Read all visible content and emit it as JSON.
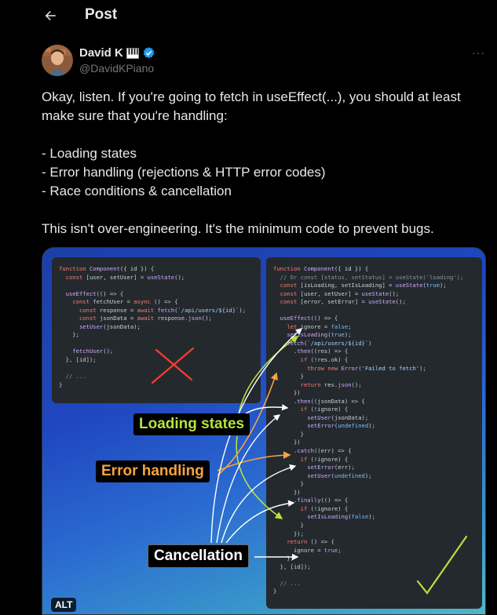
{
  "header": {
    "title": "Post",
    "back_icon": "arrow-left-icon"
  },
  "author": {
    "name": "David K",
    "name_emoji": "piano-icon",
    "verified_icon": "verified-badge-icon",
    "handle": "@DavidKPiano",
    "more_label": "···"
  },
  "post": {
    "lines": [
      "Okay, listen. If you're going to fetch in useEffect(...), you should at least make sure that you're handling:",
      "",
      "- Loading states",
      "- Error handling (rejections & HTTP error codes)",
      "- Race conditions & cancellation",
      "",
      "This isn't over-engineering. It's the minimum code to prevent bugs."
    ]
  },
  "media": {
    "alt_label": "ALT",
    "labels": {
      "loading": "Loading states",
      "error": "Error handling",
      "cancel": "Cancellation"
    },
    "colors": {
      "loading": "#b4e33d",
      "error": "#f5a442",
      "cancel": "#ffffff",
      "wrong": "#ff3b30",
      "right": "#b4e33d"
    },
    "left_code": [
      "function Component({ id }) {",
      "  const [user, setUser] = useState();",
      "",
      "  useEffect(() => {",
      "    const fetchUser = async () => {",
      "      const response = await fetch(`/api/users/${id}`);",
      "      const jsonData = await response.json();",
      "      setUser(jsonData);",
      "    };",
      "",
      "    fetchUser();",
      "  }, [id]);",
      "",
      "  // ...",
      "}"
    ],
    "right_code": [
      "function Component({ id }) {",
      "  // Or const [status, setStatus] = useState('loading');",
      "  const [isLoading, setIsLoading] = useState(true);",
      "  const [user, setUser] = useState();",
      "  const [error, setError] = useState();",
      "",
      "  useEffect(() => {",
      "    let ignore = false;",
      "    setIsLoading(true);",
      "    fetch(`/api/users/${id}`)",
      "      .then((res) => {",
      "        if (!res.ok) {",
      "          throw new Error('Failed to fetch');",
      "        }",
      "        return res.json();",
      "      })",
      "      .then((jsonData) => {",
      "        if (!ignore) {",
      "          setUser(jsonData);",
      "          setError(undefined);",
      "        }",
      "      })",
      "      .catch((err) => {",
      "        if (!ignore) {",
      "          setError(err);",
      "          setUser(undefined);",
      "        }",
      "      })",
      "      .finally(() => {",
      "        if (!ignore) {",
      "          setIsLoading(false);",
      "        }",
      "      });",
      "    return () => {",
      "      ignore = true;",
      "    };",
      "  }, [id]);",
      "",
      "  // ...",
      "}"
    ]
  }
}
